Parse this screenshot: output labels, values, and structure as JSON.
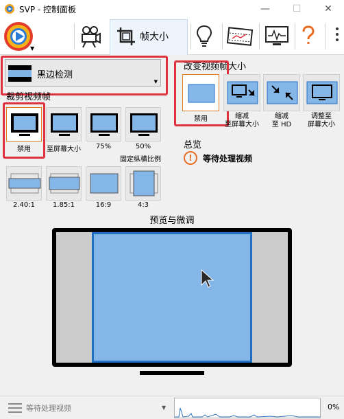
{
  "window": {
    "title": "SVP - 控制面板",
    "minimize": "—",
    "maximize": "☐",
    "close": "✕"
  },
  "toolbar": {
    "active_tab_label": "帧大小",
    "buttons": [
      {
        "name": "logo",
        "icon": "svp-logo-icon"
      },
      {
        "name": "video",
        "icon": "film-camera-icon"
      },
      {
        "name": "frame-size",
        "icon": "crop-icon"
      },
      {
        "name": "tips",
        "icon": "lightbulb-icon"
      },
      {
        "name": "filmstrip",
        "icon": "filmstrip-icon"
      },
      {
        "name": "monitor",
        "icon": "monitor-pulse-icon"
      },
      {
        "name": "help",
        "icon": "question-icon"
      },
      {
        "name": "more",
        "icon": "more-vertical-icon"
      }
    ]
  },
  "black_bar": {
    "dropdown_label": "黑边检测"
  },
  "crop": {
    "title": "裁剪视频帧",
    "row1": [
      {
        "label": "禁用",
        "active": true
      },
      {
        "label": "至屏幕大小"
      },
      {
        "label": "75%"
      },
      {
        "label": "50%"
      }
    ],
    "row1_note": "固定纵横比例",
    "row2": [
      {
        "label": "2.40:1"
      },
      {
        "label": "1.85:1"
      },
      {
        "label": "16:9"
      },
      {
        "label": "4:3"
      }
    ]
  },
  "resize": {
    "title": "改变视频帧大小",
    "options": [
      {
        "label": "禁用",
        "active": true
      },
      {
        "label": "缩减\n至屏幕大小"
      },
      {
        "label": "缩减\n至 HD"
      },
      {
        "label": "调整至\n屏幕大小"
      }
    ]
  },
  "summary": {
    "title": "总览",
    "status": "等待处理视频"
  },
  "preview": {
    "title": "预览与微调"
  },
  "statusbar": {
    "text": "等待处理视频",
    "percent": "0%"
  },
  "colors": {
    "accent_red": "#e0313f",
    "picture_fill": "#84b6e8",
    "picture_border": "#1f6fc4",
    "active_tile_border": "#e07a1f",
    "status_orange": "#e8702a"
  }
}
